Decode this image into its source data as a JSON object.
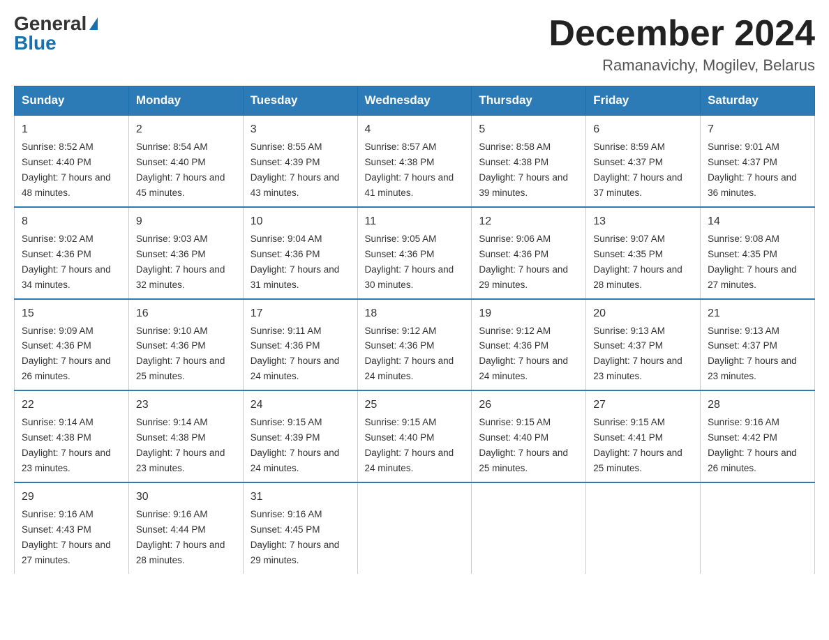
{
  "logo": {
    "general": "General",
    "blue": "Blue"
  },
  "header": {
    "title": "December 2024",
    "location": "Ramanavichy, Mogilev, Belarus"
  },
  "weekdays": [
    "Sunday",
    "Monday",
    "Tuesday",
    "Wednesday",
    "Thursday",
    "Friday",
    "Saturday"
  ],
  "weeks": [
    [
      {
        "day": "1",
        "sunrise": "8:52 AM",
        "sunset": "4:40 PM",
        "daylight": "7 hours and 48 minutes."
      },
      {
        "day": "2",
        "sunrise": "8:54 AM",
        "sunset": "4:40 PM",
        "daylight": "7 hours and 45 minutes."
      },
      {
        "day": "3",
        "sunrise": "8:55 AM",
        "sunset": "4:39 PM",
        "daylight": "7 hours and 43 minutes."
      },
      {
        "day": "4",
        "sunrise": "8:57 AM",
        "sunset": "4:38 PM",
        "daylight": "7 hours and 41 minutes."
      },
      {
        "day": "5",
        "sunrise": "8:58 AM",
        "sunset": "4:38 PM",
        "daylight": "7 hours and 39 minutes."
      },
      {
        "day": "6",
        "sunrise": "8:59 AM",
        "sunset": "4:37 PM",
        "daylight": "7 hours and 37 minutes."
      },
      {
        "day": "7",
        "sunrise": "9:01 AM",
        "sunset": "4:37 PM",
        "daylight": "7 hours and 36 minutes."
      }
    ],
    [
      {
        "day": "8",
        "sunrise": "9:02 AM",
        "sunset": "4:36 PM",
        "daylight": "7 hours and 34 minutes."
      },
      {
        "day": "9",
        "sunrise": "9:03 AM",
        "sunset": "4:36 PM",
        "daylight": "7 hours and 32 minutes."
      },
      {
        "day": "10",
        "sunrise": "9:04 AM",
        "sunset": "4:36 PM",
        "daylight": "7 hours and 31 minutes."
      },
      {
        "day": "11",
        "sunrise": "9:05 AM",
        "sunset": "4:36 PM",
        "daylight": "7 hours and 30 minutes."
      },
      {
        "day": "12",
        "sunrise": "9:06 AM",
        "sunset": "4:36 PM",
        "daylight": "7 hours and 29 minutes."
      },
      {
        "day": "13",
        "sunrise": "9:07 AM",
        "sunset": "4:35 PM",
        "daylight": "7 hours and 28 minutes."
      },
      {
        "day": "14",
        "sunrise": "9:08 AM",
        "sunset": "4:35 PM",
        "daylight": "7 hours and 27 minutes."
      }
    ],
    [
      {
        "day": "15",
        "sunrise": "9:09 AM",
        "sunset": "4:36 PM",
        "daylight": "7 hours and 26 minutes."
      },
      {
        "day": "16",
        "sunrise": "9:10 AM",
        "sunset": "4:36 PM",
        "daylight": "7 hours and 25 minutes."
      },
      {
        "day": "17",
        "sunrise": "9:11 AM",
        "sunset": "4:36 PM",
        "daylight": "7 hours and 24 minutes."
      },
      {
        "day": "18",
        "sunrise": "9:12 AM",
        "sunset": "4:36 PM",
        "daylight": "7 hours and 24 minutes."
      },
      {
        "day": "19",
        "sunrise": "9:12 AM",
        "sunset": "4:36 PM",
        "daylight": "7 hours and 24 minutes."
      },
      {
        "day": "20",
        "sunrise": "9:13 AM",
        "sunset": "4:37 PM",
        "daylight": "7 hours and 23 minutes."
      },
      {
        "day": "21",
        "sunrise": "9:13 AM",
        "sunset": "4:37 PM",
        "daylight": "7 hours and 23 minutes."
      }
    ],
    [
      {
        "day": "22",
        "sunrise": "9:14 AM",
        "sunset": "4:38 PM",
        "daylight": "7 hours and 23 minutes."
      },
      {
        "day": "23",
        "sunrise": "9:14 AM",
        "sunset": "4:38 PM",
        "daylight": "7 hours and 23 minutes."
      },
      {
        "day": "24",
        "sunrise": "9:15 AM",
        "sunset": "4:39 PM",
        "daylight": "7 hours and 24 minutes."
      },
      {
        "day": "25",
        "sunrise": "9:15 AM",
        "sunset": "4:40 PM",
        "daylight": "7 hours and 24 minutes."
      },
      {
        "day": "26",
        "sunrise": "9:15 AM",
        "sunset": "4:40 PM",
        "daylight": "7 hours and 25 minutes."
      },
      {
        "day": "27",
        "sunrise": "9:15 AM",
        "sunset": "4:41 PM",
        "daylight": "7 hours and 25 minutes."
      },
      {
        "day": "28",
        "sunrise": "9:16 AM",
        "sunset": "4:42 PM",
        "daylight": "7 hours and 26 minutes."
      }
    ],
    [
      {
        "day": "29",
        "sunrise": "9:16 AM",
        "sunset": "4:43 PM",
        "daylight": "7 hours and 27 minutes."
      },
      {
        "day": "30",
        "sunrise": "9:16 AM",
        "sunset": "4:44 PM",
        "daylight": "7 hours and 28 minutes."
      },
      {
        "day": "31",
        "sunrise": "9:16 AM",
        "sunset": "4:45 PM",
        "daylight": "7 hours and 29 minutes."
      },
      null,
      null,
      null,
      null
    ]
  ]
}
